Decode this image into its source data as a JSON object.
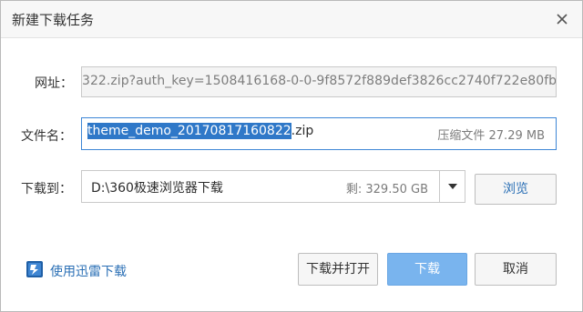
{
  "dialog": {
    "title": "新建下载任务"
  },
  "url_row": {
    "label": "网址：",
    "value": "322.zip?auth_key=1508416168-0-0-9f8572f889def3826cc2740f722e80fb"
  },
  "filename_row": {
    "label": "文件名：",
    "name_selected": "theme_demo_20170817160822",
    "extension": ".zip",
    "file_type": "压缩文件",
    "file_size": "27.29 MB"
  },
  "save_row": {
    "label": "下载到：",
    "path": "D:\\360极速浏览器下载",
    "free_space": "剩: 329.50 GB",
    "browse_label": "浏览"
  },
  "footer": {
    "thunder_label": "使用迅雷下载",
    "download_open_label": "下载并打开",
    "download_label": "下载",
    "cancel_label": "取消"
  },
  "colors": {
    "accent": "#2a6fb5",
    "primary_button": "#79b4ee",
    "selection": "#2f78c8"
  },
  "icons": {
    "close": "close-icon",
    "dropdown": "chevron-down-icon",
    "thunder": "thunder-icon"
  }
}
